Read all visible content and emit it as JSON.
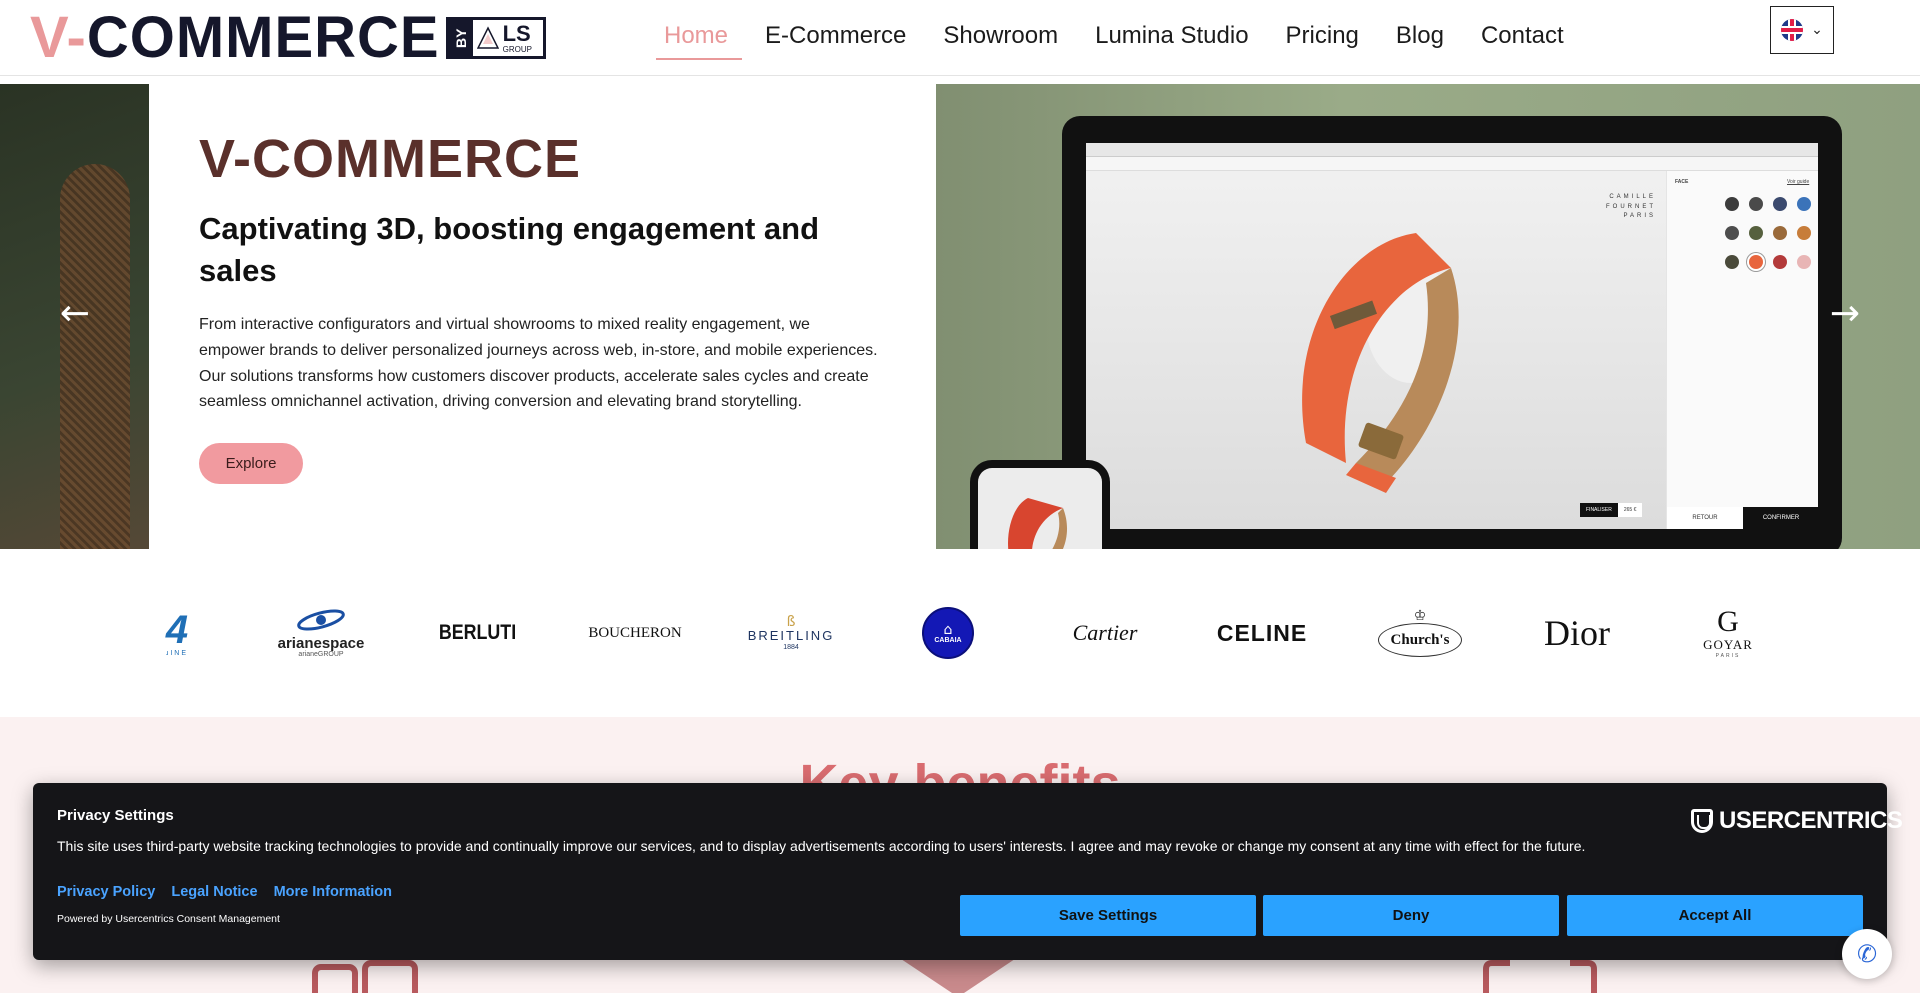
{
  "header": {
    "logo_v": "V-",
    "logo_main": "COMMERCE",
    "logo_by": "BY",
    "logo_ls": "LS",
    "logo_group": "GROUP",
    "nav": [
      {
        "label": "Home",
        "active": true
      },
      {
        "label": "E-Commerce"
      },
      {
        "label": "Showroom"
      },
      {
        "label": "Lumina Studio"
      },
      {
        "label": "Pricing"
      },
      {
        "label": "Blog"
      },
      {
        "label": "Contact"
      }
    ],
    "language_icon": "uk-flag-icon"
  },
  "hero": {
    "title": "V-COMMERCE",
    "subtitle": "Captivating 3D, boosting engagement and sales",
    "text": "From interactive configurators and virtual showrooms to mixed reality engagement, we empower brands to deliver personalized journeys across web, in-store, and mobile experiences. Our solutions transforms how customers discover products, accelerate sales cycles and create seamless omnichannel activation, driving conversion and elevating brand storytelling.",
    "cta": "Explore",
    "mock": {
      "brandtag": "CAMILLE FOURNET PARIS",
      "panel_title": "FACE",
      "panel_link": "Voir guide",
      "finalize": "FINALISER",
      "price": "265 €",
      "back": "RETOUR",
      "confirm": "CONFIRMER"
    }
  },
  "brands": [
    {
      "name": "4 PINE",
      "text": "4"
    },
    {
      "name": "arianespace",
      "text": "arianespace"
    },
    {
      "name": "BERLUTI",
      "text": "BERLUTI"
    },
    {
      "name": "BOUCHERON",
      "text": "BOUCHERON"
    },
    {
      "name": "BREITLING",
      "text": "BREITLING"
    },
    {
      "name": "CABAIA",
      "text": "CABAIA"
    },
    {
      "name": "Cartier",
      "text": "Cartier"
    },
    {
      "name": "CELINE",
      "text": "CELINE"
    },
    {
      "name": "Church's",
      "text": "Church's"
    },
    {
      "name": "Dior",
      "text": "Dior"
    },
    {
      "name": "GOYAR",
      "text": "GOYAR"
    }
  ],
  "benefits": {
    "title": "Key benefits"
  },
  "cookie": {
    "title": "Privacy Settings",
    "text": "This site uses third-party website tracking technologies to provide and continually improve our services, and to display advertisements according to users' interests. I agree and may revoke or change my consent at any time with effect for the future.",
    "links": [
      "Privacy Policy",
      "Legal Notice",
      "More Information"
    ],
    "powered": "Powered by Usercentrics Consent Management",
    "brand": "USERCENTRICS",
    "buttons": {
      "save": "Save Settings",
      "deny": "Deny",
      "accept": "Accept All"
    }
  },
  "colors": {
    "accent": "#e9999a",
    "hero_title": "#5a302b",
    "cookie_bg": "#151518",
    "cookie_button": "#2aa2ff",
    "benefits_title": "#d96c70"
  }
}
